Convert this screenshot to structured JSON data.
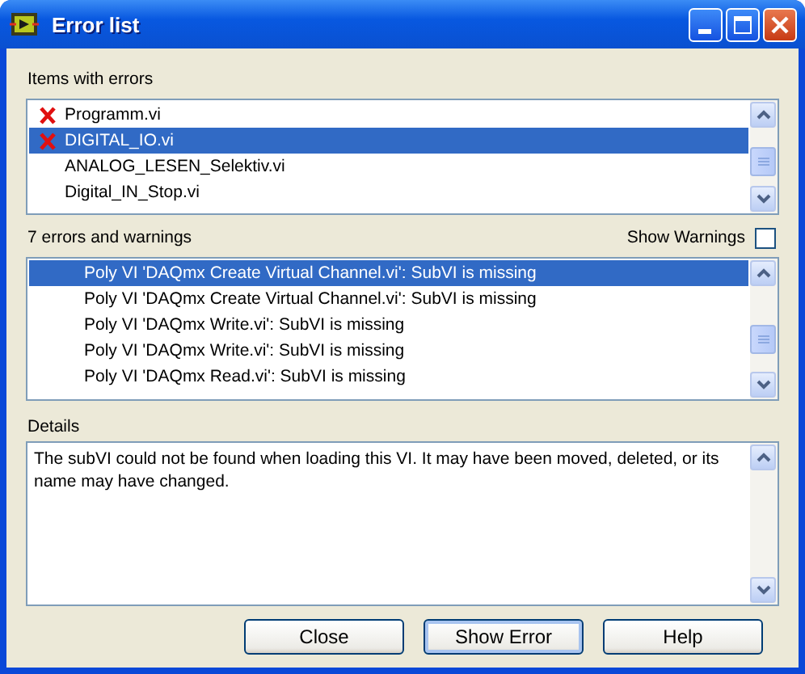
{
  "window": {
    "title": "Error list"
  },
  "items_section": {
    "label": "Items with errors"
  },
  "items": [
    {
      "name": "Programm.vi",
      "has_error": true,
      "selected": false
    },
    {
      "name": "DIGITAL_IO.vi",
      "has_error": true,
      "selected": true
    },
    {
      "name": "ANALOG_LESEN_Selektiv.vi",
      "has_error": false,
      "selected": false
    },
    {
      "name": "Digital_IN_Stop.vi",
      "has_error": false,
      "selected": false
    }
  ],
  "errors_section": {
    "label": "7 errors and warnings",
    "show_warnings": {
      "label": "Show Warnings",
      "checked": false
    }
  },
  "errors": [
    {
      "text": "Poly VI 'DAQmx Create Virtual Channel.vi': SubVI is missing",
      "selected": true
    },
    {
      "text": "Poly VI 'DAQmx Create Virtual Channel.vi': SubVI is missing",
      "selected": false
    },
    {
      "text": "Poly VI 'DAQmx Write.vi': SubVI is missing",
      "selected": false
    },
    {
      "text": "Poly VI 'DAQmx Write.vi': SubVI is missing",
      "selected": false
    },
    {
      "text": "Poly VI 'DAQmx Read.vi': SubVI is missing",
      "selected": false
    }
  ],
  "details": {
    "label": "Details",
    "text": "The subVI could not be found when loading this VI. It may have been moved, deleted, or its name may have changed."
  },
  "buttons": [
    {
      "label": "Close",
      "default": false
    },
    {
      "label": "Show Error",
      "default": true
    },
    {
      "label": "Help",
      "default": false
    }
  ]
}
